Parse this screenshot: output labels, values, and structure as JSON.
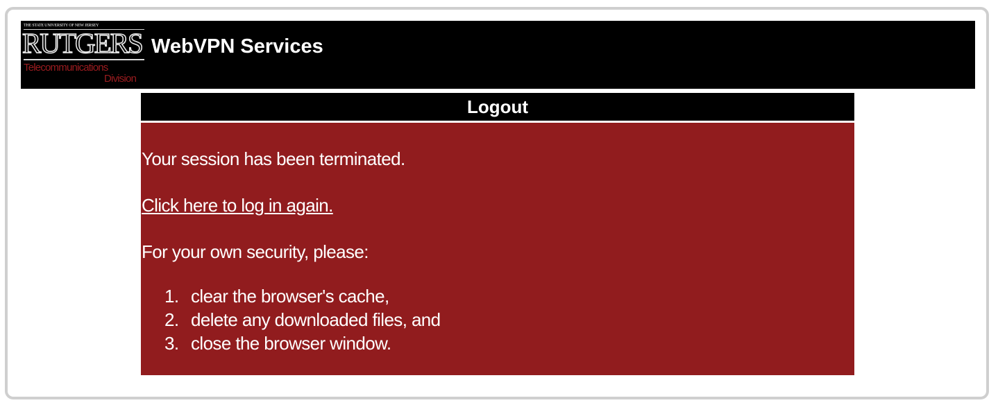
{
  "header": {
    "logo": {
      "top_line": "THE STATE UNIVERSITY OF NEW JERSEY",
      "name": "RUTGERS",
      "sub_line1": "Telecommunications",
      "sub_line2": "Division"
    },
    "title": "WebVPN Services"
  },
  "panel": {
    "title": "Logout",
    "message": "Your session has been terminated.",
    "relogin_link": "Click here to log in again.",
    "security_intro": "For your own security, please:",
    "steps": [
      {
        "num": "1.",
        "text": "clear the browser's cache,"
      },
      {
        "num": "2.",
        "text": "delete any downloaded files, and"
      },
      {
        "num": "3.",
        "text": "close the browser window."
      }
    ]
  },
  "colors": {
    "header_bg": "#000000",
    "panel_bg": "#911c1e",
    "logo_red": "#9b1c1f"
  }
}
